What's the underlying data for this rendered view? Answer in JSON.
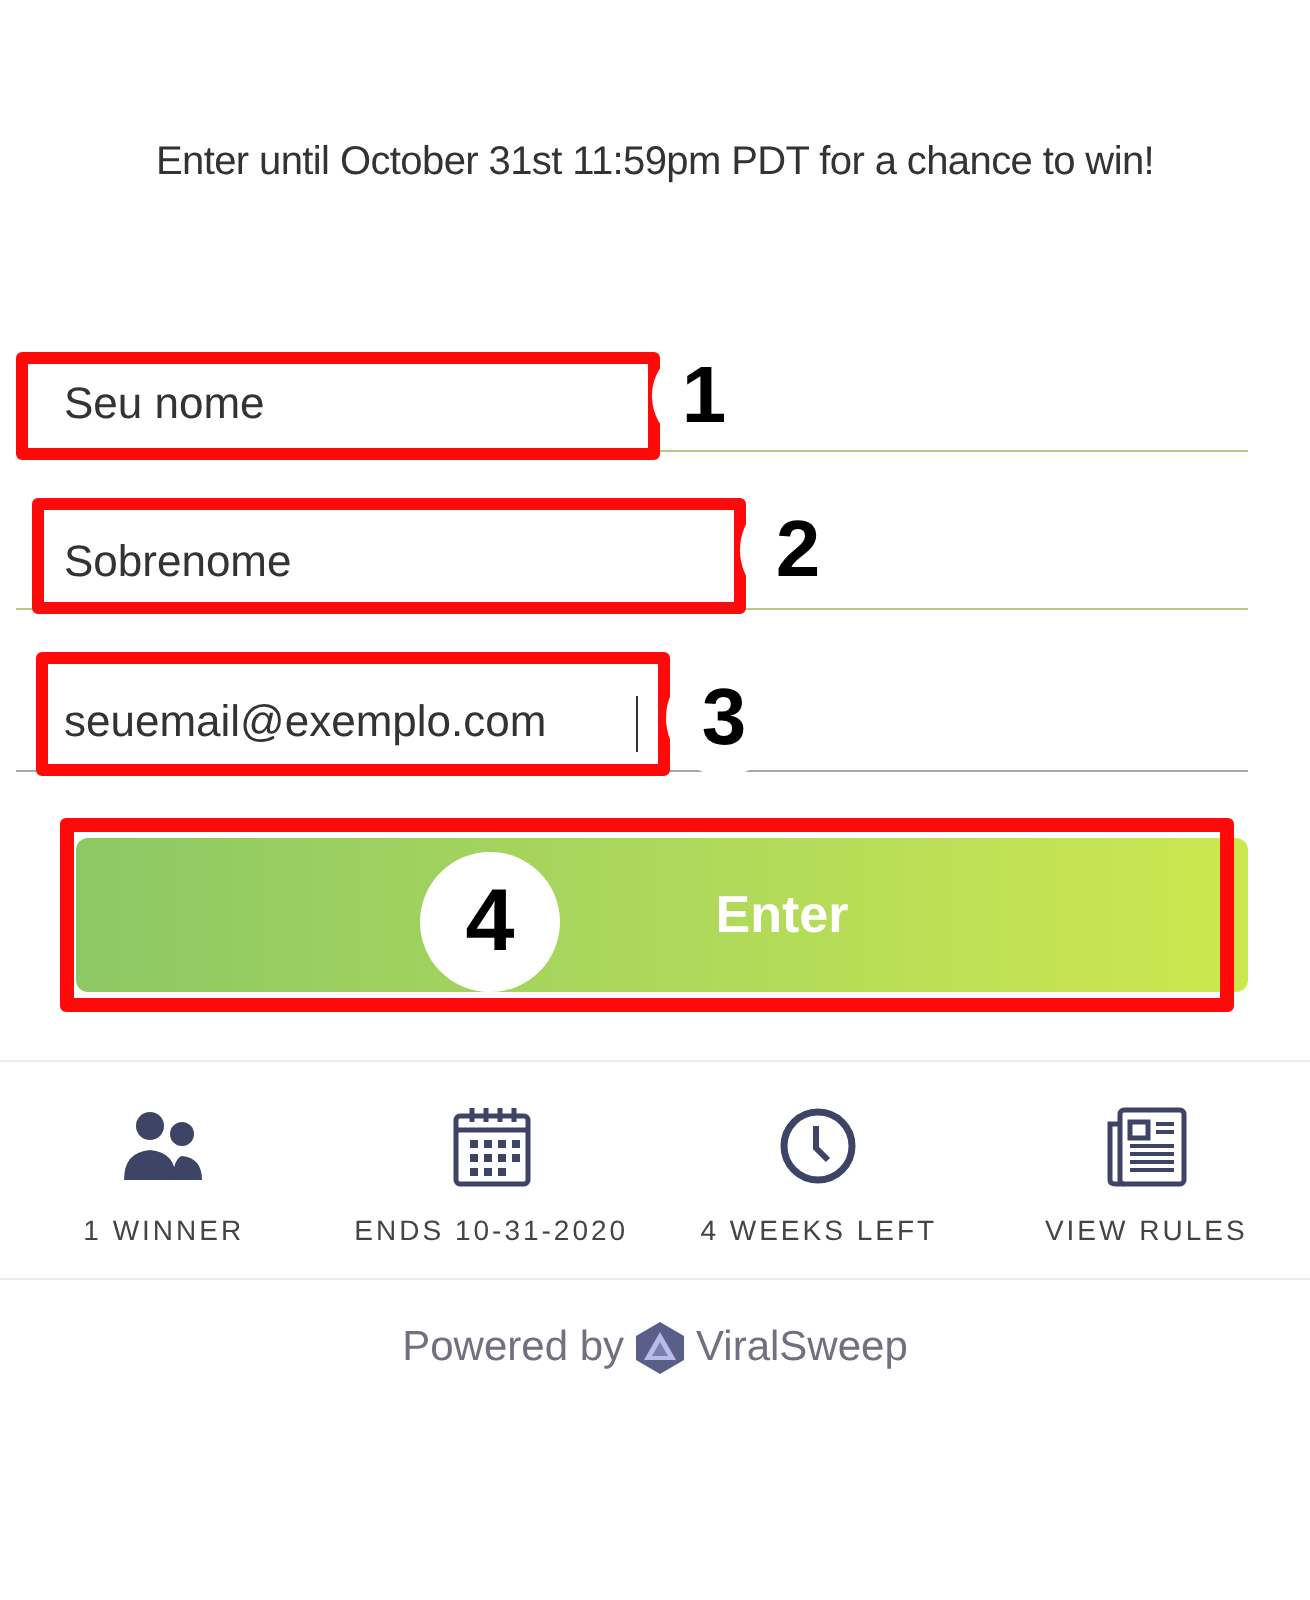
{
  "headline": "Enter until October 31st 11:59pm PDT for a chance to win!",
  "fields": [
    {
      "value": "Seu nome",
      "focused": false,
      "annotation": "1"
    },
    {
      "value": "Sobrenome",
      "focused": false,
      "annotation": "2"
    },
    {
      "value": "seuemail@exemplo.com",
      "focused": true,
      "annotation": "3"
    }
  ],
  "submit": {
    "label": "Enter",
    "annotation": "4"
  },
  "stats": [
    {
      "label": "1 WINNER"
    },
    {
      "label": "ENDS 10-31-2020"
    },
    {
      "label": "4 WEEKS LEFT"
    },
    {
      "label": "VIEW RULES"
    }
  ],
  "footer": {
    "prefix": "Powered by",
    "brand": "ViralSweep"
  }
}
